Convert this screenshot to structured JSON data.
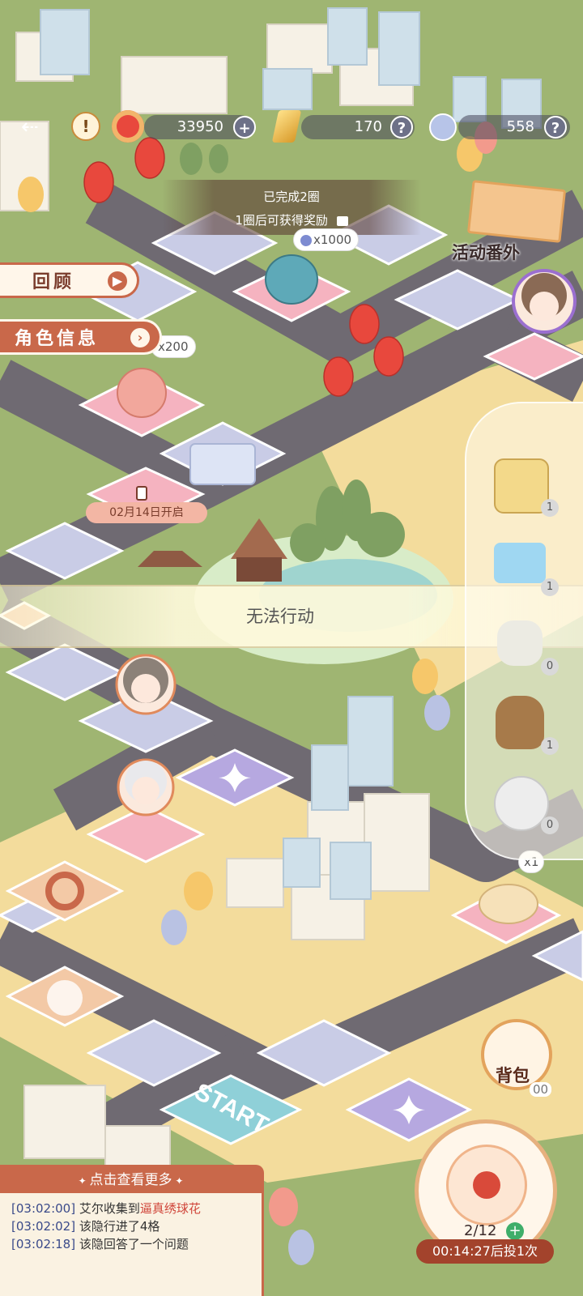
{
  "top_bar": {
    "coins": "33950",
    "crystals": "170",
    "tokens": "558",
    "icons": [
      "back-arrow-icon",
      "alert-icon",
      "lantern-icon",
      "plus-icon",
      "crystal-icon",
      "help-icon",
      "token-icon",
      "help-icon"
    ]
  },
  "lap_info": {
    "completed": "已完成2圈",
    "reward_hint": "1圈后可获得奖励"
  },
  "side_buttons": {
    "review": "回顾",
    "character_info": "角色信息"
  },
  "event_extra": "活动番外",
  "tile_rewards": {
    "top": "x1000",
    "left": "x200",
    "right": "x1"
  },
  "locked_tile": "02月14日开启",
  "status_banner": "无法行动",
  "inventory": {
    "items": [
      {
        "name": "dice",
        "count": "1"
      },
      {
        "name": "arrow-card",
        "count": "1"
      },
      {
        "name": "glove",
        "count": "0"
      },
      {
        "name": "sack",
        "count": "1"
      },
      {
        "name": "snowball",
        "count": "0"
      }
    ]
  },
  "start_tile": "START",
  "bag": {
    "label": "背包",
    "badge": "00"
  },
  "log": {
    "header": "点击查看更多",
    "entries": [
      {
        "time": "[03:02:00]",
        "prefix": "艾尔收集到",
        "highlight": "逼真绣球花"
      },
      {
        "time": "[03:02:02]",
        "prefix": "该隐行进了4格",
        "highlight": ""
      },
      {
        "time": "[03:02:18]",
        "prefix": "该隐回答了一个问题",
        "highlight": ""
      }
    ]
  },
  "roll": {
    "count": "2/12",
    "timer": "00:14:27后投1次"
  },
  "colors": {
    "grass": "#9fb572",
    "road": "#6f6a72",
    "tile_blue": "#c9cce6",
    "tile_pink": "#f5b3c0",
    "tile_purple": "#b6a8e0",
    "sand": "#f5dfa0",
    "accent": "#c9684a"
  }
}
